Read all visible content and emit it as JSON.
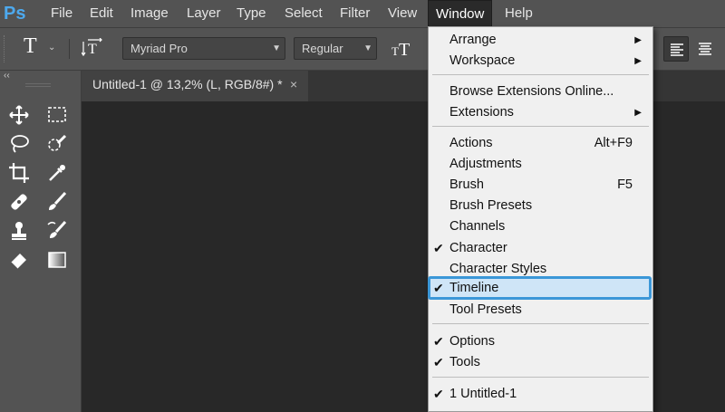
{
  "app": {
    "logo": "Ps"
  },
  "menubar": {
    "items": [
      {
        "label": "File"
      },
      {
        "label": "Edit"
      },
      {
        "label": "Image"
      },
      {
        "label": "Layer"
      },
      {
        "label": "Type"
      },
      {
        "label": "Select"
      },
      {
        "label": "Filter"
      },
      {
        "label": "View"
      },
      {
        "label": "Window"
      },
      {
        "label": "Help"
      }
    ],
    "open_menu": "Window"
  },
  "options": {
    "tool_icon": "T",
    "font_family": "Myriad Pro",
    "font_style": "Regular",
    "orient_icon": "text-orientation-icon",
    "size_icon": "text-size-icon"
  },
  "document": {
    "tab_title": "Untitled-1 @ 13,2% (L, RGB/8#) *",
    "close_glyph": "×"
  },
  "toolbar": {
    "collapse_glyph": "‹‹",
    "tools": [
      "move-icon",
      "marquee-icon",
      "lasso-icon",
      "quick-select-icon",
      "crop-icon",
      "eyedropper-icon",
      "healing-icon",
      "brush-icon",
      "stamp-icon",
      "history-brush-icon",
      "eraser-icon",
      "gradient-icon"
    ]
  },
  "window_menu": {
    "items": [
      {
        "label": "Arrange",
        "submenu": "▶",
        "checked": "",
        "shortcut": ""
      },
      {
        "label": "Workspace",
        "submenu": "▶",
        "checked": "",
        "shortcut": ""
      },
      {
        "label": "Browse Extensions Online...",
        "submenu": "",
        "checked": "",
        "shortcut": ""
      },
      {
        "label": "Extensions",
        "submenu": "▶",
        "checked": "",
        "shortcut": ""
      },
      {
        "label": "Actions",
        "submenu": "",
        "checked": "",
        "shortcut": "Alt+F9"
      },
      {
        "label": "Adjustments",
        "submenu": "",
        "checked": "",
        "shortcut": ""
      },
      {
        "label": "Brush",
        "submenu": "",
        "checked": "",
        "shortcut": "F5"
      },
      {
        "label": "Brush Presets",
        "submenu": "",
        "checked": "",
        "shortcut": ""
      },
      {
        "label": "Channels",
        "submenu": "",
        "checked": "",
        "shortcut": ""
      },
      {
        "label": "Character",
        "submenu": "",
        "checked": "✔",
        "shortcut": ""
      },
      {
        "label": "Character Styles",
        "submenu": "",
        "checked": "",
        "shortcut": ""
      },
      {
        "label": "Timeline",
        "submenu": "",
        "checked": "✔",
        "shortcut": ""
      },
      {
        "label": "Tool Presets",
        "submenu": "",
        "checked": "",
        "shortcut": ""
      },
      {
        "label": "Options",
        "submenu": "",
        "checked": "✔",
        "shortcut": ""
      },
      {
        "label": "Tools",
        "submenu": "",
        "checked": "✔",
        "shortcut": ""
      },
      {
        "label": "1 Untitled-1",
        "submenu": "",
        "checked": "✔",
        "shortcut": ""
      }
    ],
    "highlighted": "Timeline"
  },
  "colors": {
    "menubar_bg": "#535353",
    "canvas_bg": "#282828",
    "menu_bg": "#f0f0f0",
    "highlight_border": "#3b97d8",
    "highlight_fill": "#cfe5f7",
    "ps_blue": "#4da9ee"
  }
}
